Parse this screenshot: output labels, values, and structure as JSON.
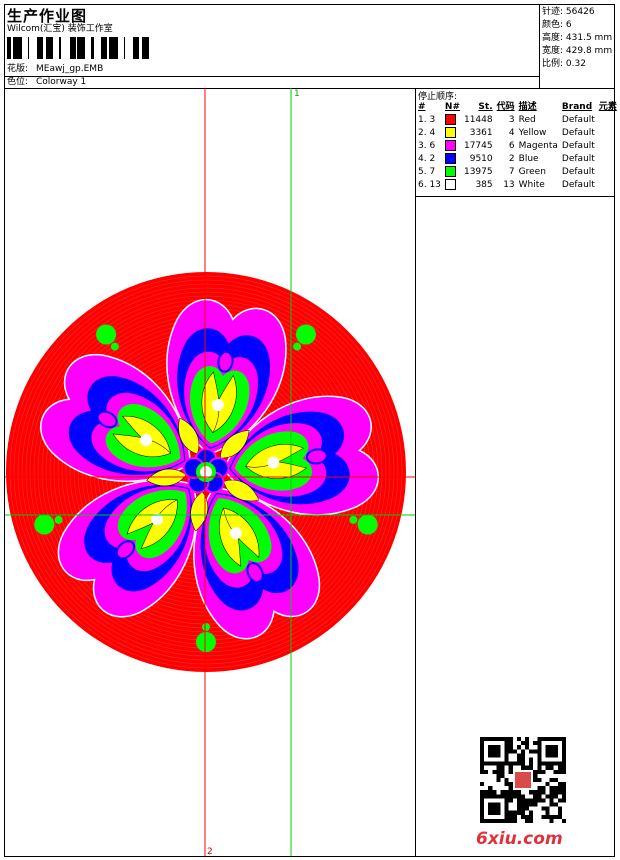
{
  "header": {
    "title": "生产作业图",
    "subtitle": "Wilcom(汇宝) 装饰工作室",
    "design_label": "花版:",
    "design_file": "MEawj_gp.EMB",
    "colorway_label": "色位:",
    "colorway": "Colorway 1"
  },
  "stats": [
    {
      "label": "针迹:",
      "value": "56426"
    },
    {
      "label": "颜色:",
      "value": "6"
    },
    {
      "label": "高度:",
      "value": "431.5 mm"
    },
    {
      "label": "宽度:",
      "value": "429.8 mm"
    },
    {
      "label": "比例:",
      "value": "0.32"
    }
  ],
  "stop_sequence": {
    "title": "停止顺序:",
    "headers": [
      "#",
      "N#",
      "St.",
      "代码",
      "描述",
      "Brand",
      "元素"
    ],
    "rows": [
      {
        "idx": "1. 3",
        "stitches": "11448",
        "code": "3",
        "desc": "Red",
        "brand": "Default",
        "color": "#ff0000"
      },
      {
        "idx": "2. 4",
        "stitches": "3361",
        "code": "4",
        "desc": "Yellow",
        "brand": "Default",
        "color": "#ffff00"
      },
      {
        "idx": "3. 6",
        "stitches": "17745",
        "code": "6",
        "desc": "Magenta",
        "brand": "Default",
        "color": "#ff00ff"
      },
      {
        "idx": "4. 2",
        "stitches": "9510",
        "code": "2",
        "desc": "Blue",
        "brand": "Default",
        "color": "#0000ff"
      },
      {
        "idx": "5. 7",
        "stitches": "13975",
        "code": "7",
        "desc": "Green",
        "brand": "Default",
        "color": "#00ff00"
      },
      {
        "idx": "6. 13",
        "stitches": "385",
        "code": "13",
        "desc": "White",
        "brand": "Default",
        "color": "#ffffff"
      }
    ]
  },
  "design": {
    "vertical_axis_label": "1",
    "horizontal_axis_label": "2",
    "axis_red": "#ff0000",
    "axis_green": "#00cc00"
  },
  "watermark": {
    "brand": "6xiu.com"
  }
}
